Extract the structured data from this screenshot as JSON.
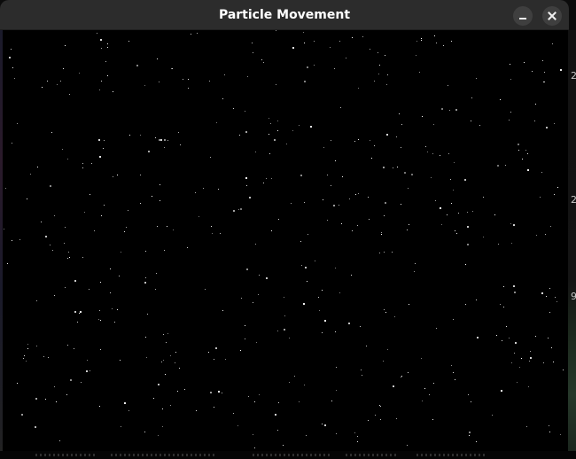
{
  "window": {
    "title": "Particle Movement",
    "minimize_icon": "minimize-icon",
    "close_icon": "close-icon"
  },
  "canvas": {
    "background": "#000000",
    "particle_color": "#ffffff"
  },
  "desktop": {
    "right_glyphs": [
      "2",
      "2",
      "9"
    ]
  }
}
